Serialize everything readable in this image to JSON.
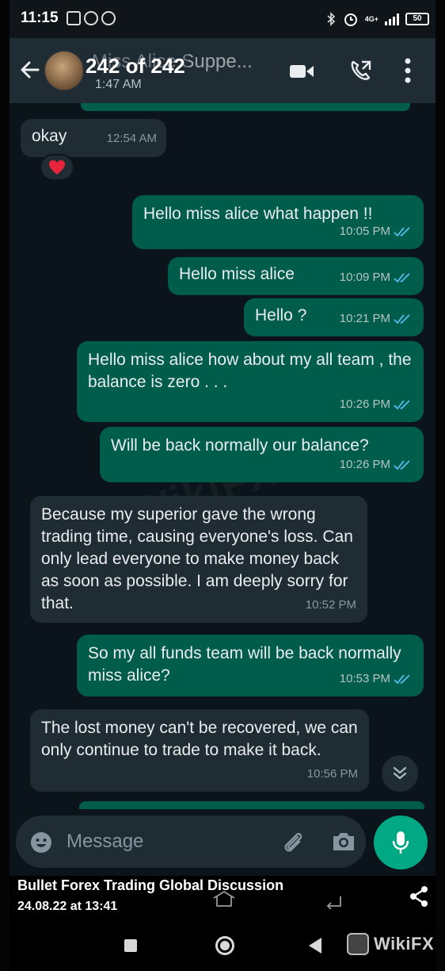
{
  "status_bar": {
    "time": "11:15",
    "network": "4G+",
    "battery": "50"
  },
  "header": {
    "contact_name": "Miss Alice Suppe...",
    "search_counter": "242 of 242",
    "last_seen": "1:47 AM"
  },
  "messages": [
    {
      "direction": "in",
      "text": "okay",
      "time": "12:54 AM",
      "reaction": "heart-icon"
    },
    {
      "direction": "out",
      "text": "Hello miss alice what happen !!",
      "time": "10:05 PM"
    },
    {
      "direction": "out",
      "text": "Hello miss alice",
      "time": "10:09 PM"
    },
    {
      "direction": "out",
      "text": "Hello ?",
      "time": "10:21 PM"
    },
    {
      "direction": "out",
      "text": "Hello miss alice how about my all team , the balance is zero . . .",
      "time": "10:26 PM"
    },
    {
      "direction": "out",
      "text": "Will be back normally our balance?",
      "time": "10:26 PM"
    },
    {
      "direction": "in",
      "text": "Because my superior gave the wrong trading time, causing everyone's loss. Can only lead everyone to make money back as soon as possible. I am deeply sorry for that.",
      "time": "10:52 PM"
    },
    {
      "direction": "out",
      "text": "So my all funds team will be back normally miss alice?",
      "time": "10:53 PM"
    },
    {
      "direction": "in",
      "text": "The lost money can't be recovered, we can only continue to trade to make it back.",
      "time": "10:56 PM"
    }
  ],
  "input": {
    "placeholder": "Message"
  },
  "caption": {
    "title": "Bullet Forex Trading Global Discussion",
    "date": "24.08.22 at 13:41"
  },
  "brand": {
    "text": "WikiFX"
  },
  "colors": {
    "bubble_out": "#005c4b",
    "bubble_in": "#1f2c33",
    "header_bg": "#1f2c33",
    "chat_bg": "#0b141a",
    "mic_button": "#00a884",
    "read_ticks": "#53bdeb"
  }
}
